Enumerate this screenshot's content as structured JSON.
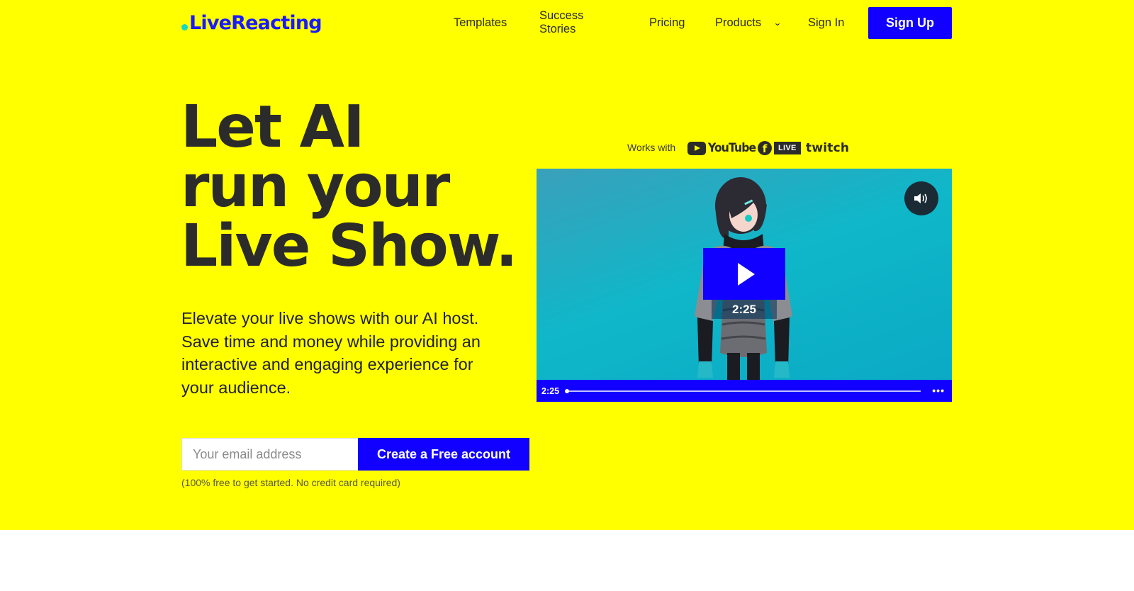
{
  "colors": {
    "hero_bg": "#ffff00",
    "accent": "#1100ff",
    "logo": "#1a1aff",
    "logo_dot": "#14d8c4",
    "text_dark": "#2b2b2b",
    "video_bg": "#0fb7c9"
  },
  "header": {
    "logo_text": "LiveReacting",
    "nav": {
      "templates": "Templates",
      "success_stories": "Success Stories",
      "pricing": "Pricing",
      "products": "Products",
      "sign_in": "Sign In"
    },
    "sign_up_label": "Sign Up"
  },
  "hero": {
    "headline_lines": [
      "Let AI",
      "run your",
      "Live Show."
    ],
    "subtext": "Elevate your live shows with our AI host. Save time and money while providing an interactive and engaging experience for your audience.",
    "email_placeholder": "Your email address",
    "cta_label": "Create a Free account",
    "fineprint": "(100% free to get started. No credit card required)"
  },
  "works_with": {
    "label": "Works with",
    "platforms": {
      "youtube": "YouTube",
      "facebook_icon": "f",
      "facebook_badge": "LIVE",
      "twitch": "twitch"
    }
  },
  "video": {
    "duration_badge": "2:25",
    "time_label": "2:25",
    "progress": 0,
    "icons": {
      "mute": "speaker-icon",
      "play": "play-icon",
      "more": "more-icon"
    }
  }
}
